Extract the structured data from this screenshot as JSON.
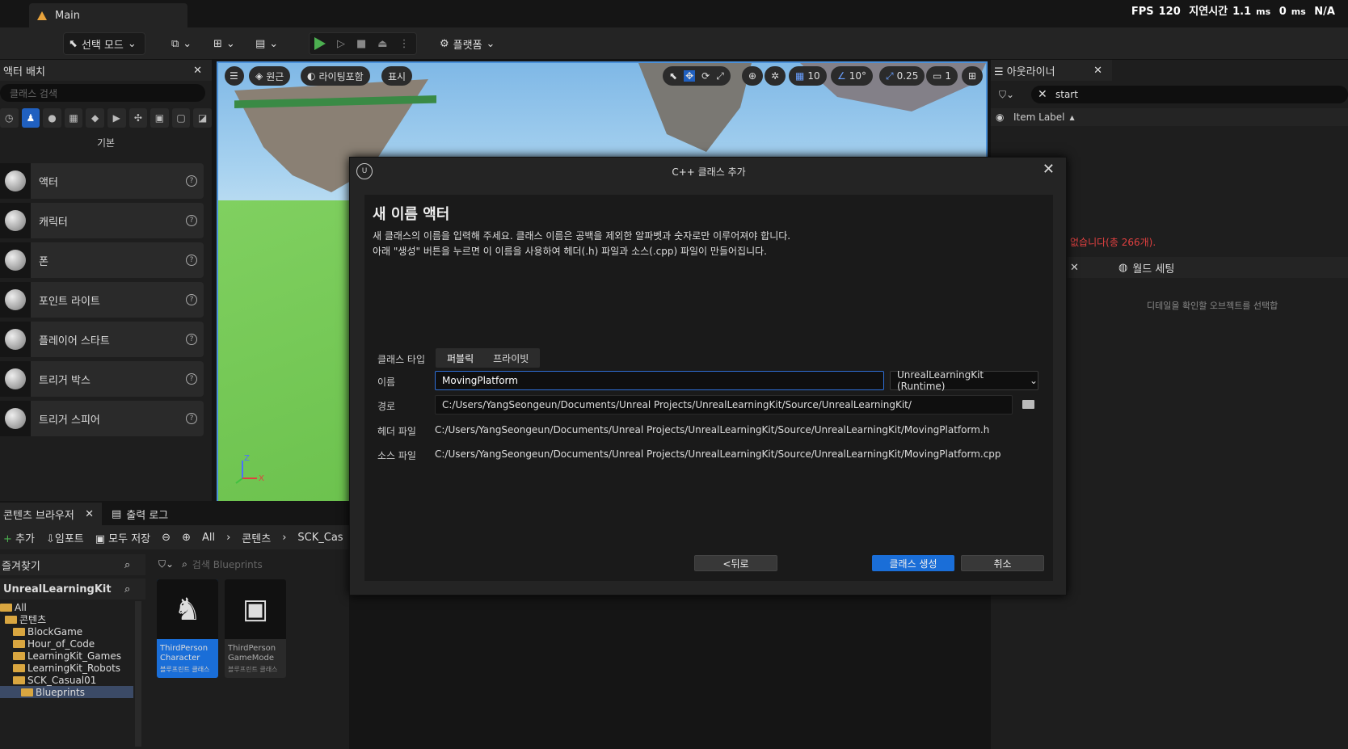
{
  "window": {
    "tab_title": "Main",
    "stats": {
      "fps_label": "FPS",
      "fps": "120",
      "latency_label": "지연시간",
      "latency1": "1.1",
      "unit1": "ms",
      "latency2": "0",
      "unit2": "ms",
      "na": "N/A"
    }
  },
  "toolbar": {
    "mode": "선택 모드",
    "platforms": "플랫폼"
  },
  "place_actors": {
    "tab": "액터 배치",
    "search_placeholder": "클래스 검색",
    "category": "기본",
    "items": [
      {
        "label": "액터"
      },
      {
        "label": "캐릭터"
      },
      {
        "label": "폰"
      },
      {
        "label": "포인트 라이트"
      },
      {
        "label": "플레이어 스타트"
      },
      {
        "label": "트리거 박스"
      },
      {
        "label": "트리거 스피어"
      }
    ]
  },
  "viewport": {
    "perspective": "원근",
    "lit": "라이팅포함",
    "show": "표시",
    "grid": "10",
    "rot": "10°",
    "scale": "0.25",
    "cam": "1",
    "axis_z": "Z",
    "axis_x": "X"
  },
  "outliner": {
    "tab": "아웃라이너",
    "search": "start",
    "column": "Item Label",
    "warning": "없습니다(총 266개).",
    "world_settings": "월드 세팅",
    "detail_hint": "디테일을 확인할 오브젝트를 선택합"
  },
  "content_browser": {
    "tab": "콘텐츠 브라우저",
    "log_tab": "출력 로그",
    "add": "추가",
    "import": "임포트",
    "save_all": "모두 저장",
    "breadcrumbs": [
      "All",
      "콘텐츠",
      "SCK_Cas"
    ],
    "favorites": "즐겨찾기",
    "project": "UnrealLearningKit",
    "tree": [
      {
        "label": "All"
      },
      {
        "label": "콘텐츠"
      },
      {
        "label": "BlockGame"
      },
      {
        "label": "Hour_of_Code"
      },
      {
        "label": "LearningKit_Games"
      },
      {
        "label": "LearningKit_Robots"
      },
      {
        "label": "SCK_Casual01"
      },
      {
        "label": "Blueprints"
      }
    ],
    "search_placeholder": "검색 Blueprints",
    "assets": [
      {
        "name1": "ThirdPerson",
        "name2": "Character",
        "type": "블루프린트 클래스"
      },
      {
        "name1": "ThirdPerson",
        "name2": "GameMode",
        "type": "블루프린트 클래스"
      }
    ]
  },
  "dialog": {
    "title": "C++ 클래스 추가",
    "heading": "새 이름 액터",
    "desc1": "새 클래스의 이름을 입력해 주세요. 클래스 이름은 공백을 제외한 알파벳과 숫자로만 이루어져야 합니다.",
    "desc2": "아래 \"생성\" 버튼을 누르면 이 이름을 사용하여 헤더(.h) 파일과 소스(.cpp) 파일이 만들어집니다.",
    "class_type_label": "클래스 타입",
    "public": "퍼블릭",
    "private": "프라이빗",
    "name_label": "이름",
    "name_value": "MovingPlatform",
    "module": "UnrealLearningKit (Runtime)",
    "path_label": "경로",
    "path_value": "C:/Users/YangSeongeun/Documents/Unreal Projects/UnrealLearningKit/Source/UnrealLearningKit/",
    "header_label": "헤더 파일",
    "header_value": "C:/Users/YangSeongeun/Documents/Unreal Projects/UnrealLearningKit/Source/UnrealLearningKit/MovingPlatform.h",
    "source_label": "소스 파일",
    "source_value": "C:/Users/YangSeongeun/Documents/Unreal Projects/UnrealLearningKit/Source/UnrealLearningKit/MovingPlatform.cpp",
    "back": "<뒤로",
    "create": "클래스 생성",
    "cancel": "취소"
  }
}
